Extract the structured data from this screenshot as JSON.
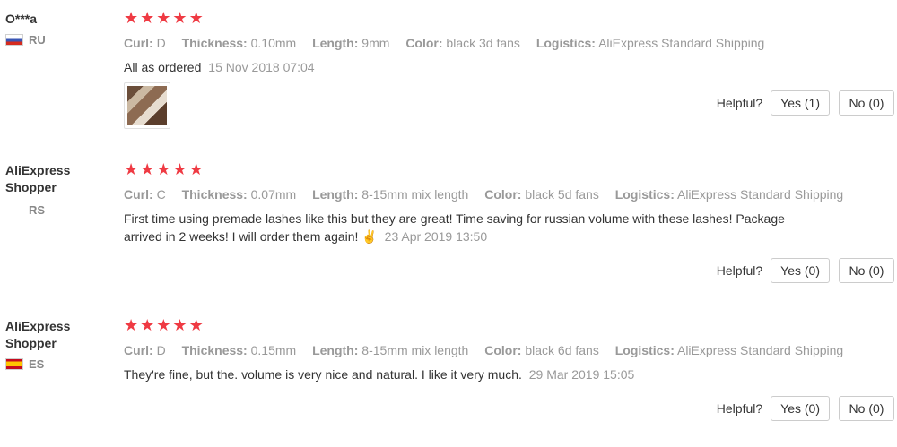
{
  "rating_glyph": "★",
  "reviews": [
    {
      "user": "O***a",
      "country": "RU",
      "flag": "ru",
      "stars": 5,
      "attrs": [
        {
          "key": "Curl:",
          "val": "D"
        },
        {
          "key": "Thickness:",
          "val": "0.10mm"
        },
        {
          "key": "Length:",
          "val": "9mm"
        },
        {
          "key": "Color:",
          "val": "black 3d fans"
        },
        {
          "key": "Logistics:",
          "val": "AliExpress Standard Shipping"
        }
      ],
      "text": "All as ordered",
      "date": "15 Nov 2018 07:04",
      "helpful_label": "Helpful?",
      "yes_label": "Yes (1)",
      "no_label": "No (0)"
    },
    {
      "user": "AliExpress Shopper",
      "country": "RS",
      "flag": "",
      "stars": 5,
      "attrs": [
        {
          "key": "Curl:",
          "val": "C"
        },
        {
          "key": "Thickness:",
          "val": "0.07mm"
        },
        {
          "key": "Length:",
          "val": "8-15mm mix length"
        },
        {
          "key": "Color:",
          "val": "black 5d fans"
        },
        {
          "key": "Logistics:",
          "val": "AliExpress Standard Shipping"
        }
      ],
      "text": "First time using premade lashes like this but they are great! Time saving for russian volume with these lashes! Package arrived in 2 weeks! I will order them again! ✌",
      "date": "23 Apr 2019 13:50",
      "helpful_label": "Helpful?",
      "yes_label": "Yes (0)",
      "no_label": "No (0)"
    },
    {
      "user": "AliExpress Shopper",
      "country": "ES",
      "flag": "es",
      "stars": 5,
      "attrs": [
        {
          "key": "Curl:",
          "val": "D"
        },
        {
          "key": "Thickness:",
          "val": "0.15mm"
        },
        {
          "key": "Length:",
          "val": "8-15mm mix length"
        },
        {
          "key": "Color:",
          "val": "black 6d fans"
        },
        {
          "key": "Logistics:",
          "val": "AliExpress Standard Shipping"
        }
      ],
      "text": "They're fine, but the. volume is very nice and natural. I like it very much.",
      "date": "29 Mar 2019 15:05",
      "helpful_label": "Helpful?",
      "yes_label": "Yes (0)",
      "no_label": "No (0)"
    }
  ]
}
